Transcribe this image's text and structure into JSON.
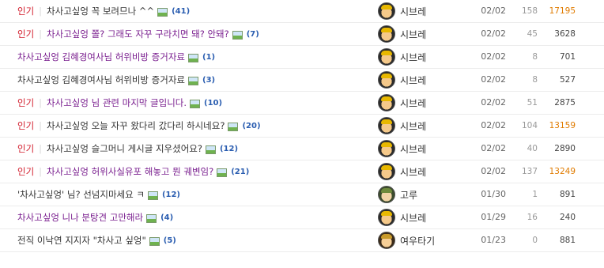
{
  "posts": [
    {
      "tag": "인기",
      "subject": "차사고싶엉 꼭 보려므나 ^^",
      "visited": false,
      "comments": "(41)",
      "author": "시브레",
      "avatar": "helmet-avatar",
      "date": "02/02",
      "votes": "158",
      "hits": "17195",
      "hot": true
    },
    {
      "tag": "인기",
      "subject": "차사고싶엉 쫄? 그래도 자꾸 구라치면 돼? 안돼?",
      "visited": true,
      "comments": "(7)",
      "author": "시브레",
      "avatar": "helmet-avatar",
      "date": "02/02",
      "votes": "45",
      "hits": "3628",
      "hot": false
    },
    {
      "tag": "",
      "subject": "차사고싶엉 김혜경여사님 허위비방 증거자료",
      "visited": true,
      "comments": "(1)",
      "author": "시브레",
      "avatar": "helmet-avatar",
      "date": "02/02",
      "votes": "8",
      "hits": "701",
      "hot": false
    },
    {
      "tag": "",
      "subject": "차사고싶엉 김혜경여사님 허위비방 증거자료",
      "visited": false,
      "comments": "(3)",
      "author": "시브레",
      "avatar": "helmet-avatar",
      "date": "02/02",
      "votes": "8",
      "hits": "527",
      "hot": false
    },
    {
      "tag": "인기",
      "subject": "차사고싶엉 님 관련 마지막 글입니다.",
      "visited": true,
      "comments": "(10)",
      "author": "시브레",
      "avatar": "helmet-avatar",
      "date": "02/02",
      "votes": "51",
      "hits": "2875",
      "hot": false
    },
    {
      "tag": "인기",
      "subject": "차사고싶엉 오늘 자꾸 왔다리 갔다리 하시네요?",
      "visited": false,
      "comments": "(20)",
      "author": "시브레",
      "avatar": "helmet-avatar",
      "date": "02/02",
      "votes": "104",
      "hits": "13159",
      "hot": true
    },
    {
      "tag": "인기",
      "subject": "차사고싶엉 슬그머니 게시글 지우셨어요?",
      "visited": false,
      "comments": "(12)",
      "author": "시브레",
      "avatar": "helmet-avatar",
      "date": "02/02",
      "votes": "40",
      "hits": "2890",
      "hot": false
    },
    {
      "tag": "인기",
      "subject": "차사고싶엉 허위사실유포 해놓고 뭔 궤변임?",
      "visited": true,
      "comments": "(21)",
      "author": "시브레",
      "avatar": "helmet-avatar",
      "date": "02/02",
      "votes": "137",
      "hits": "13249",
      "hot": true
    },
    {
      "tag": "",
      "subject": "'차사고싶엉' 님? 선넘지마세요 ㅋ",
      "visited": false,
      "comments": "(12)",
      "author": "고루",
      "avatar": "soldier-avatar",
      "date": "01/30",
      "votes": "1",
      "hits": "891",
      "hot": false
    },
    {
      "tag": "",
      "subject": "차사고싶엉 니나 분탕견 고만해라",
      "visited": true,
      "comments": "(4)",
      "author": "시브레",
      "avatar": "helmet-avatar",
      "date": "01/29",
      "votes": "16",
      "hits": "240",
      "hot": false
    },
    {
      "tag": "",
      "subject": "전직 이낙연 지지자 \"차사고 싶엉\"",
      "visited": false,
      "comments": "(5)",
      "author": "여우타기",
      "avatar": "fox-avatar",
      "date": "01/23",
      "votes": "0",
      "hits": "881",
      "hot": false
    }
  ]
}
